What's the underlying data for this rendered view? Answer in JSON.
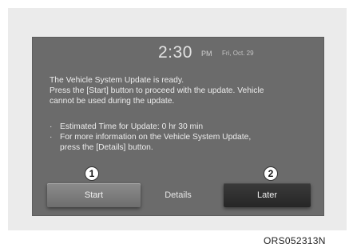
{
  "status": {
    "time": "2:30",
    "ampm": "PM",
    "date": "Fri, Oct. 29"
  },
  "message": {
    "line1": "The Vehicle System Update is ready.",
    "line2": "Press the [Start] button to proceed with the update. Vehicle",
    "line3": "cannot be used during the update."
  },
  "info": {
    "bullet_marker": "·",
    "item1": "Estimated Time for Update: 0 hr 30 min",
    "item2_line1": "For more information on the Vehicle System Update,",
    "item2_line2": "press the [Details] button."
  },
  "buttons": {
    "start": "Start",
    "details": "Details",
    "later": "Later"
  },
  "callouts": {
    "one": "1",
    "two": "2"
  },
  "figure_code": "ORS052313N"
}
